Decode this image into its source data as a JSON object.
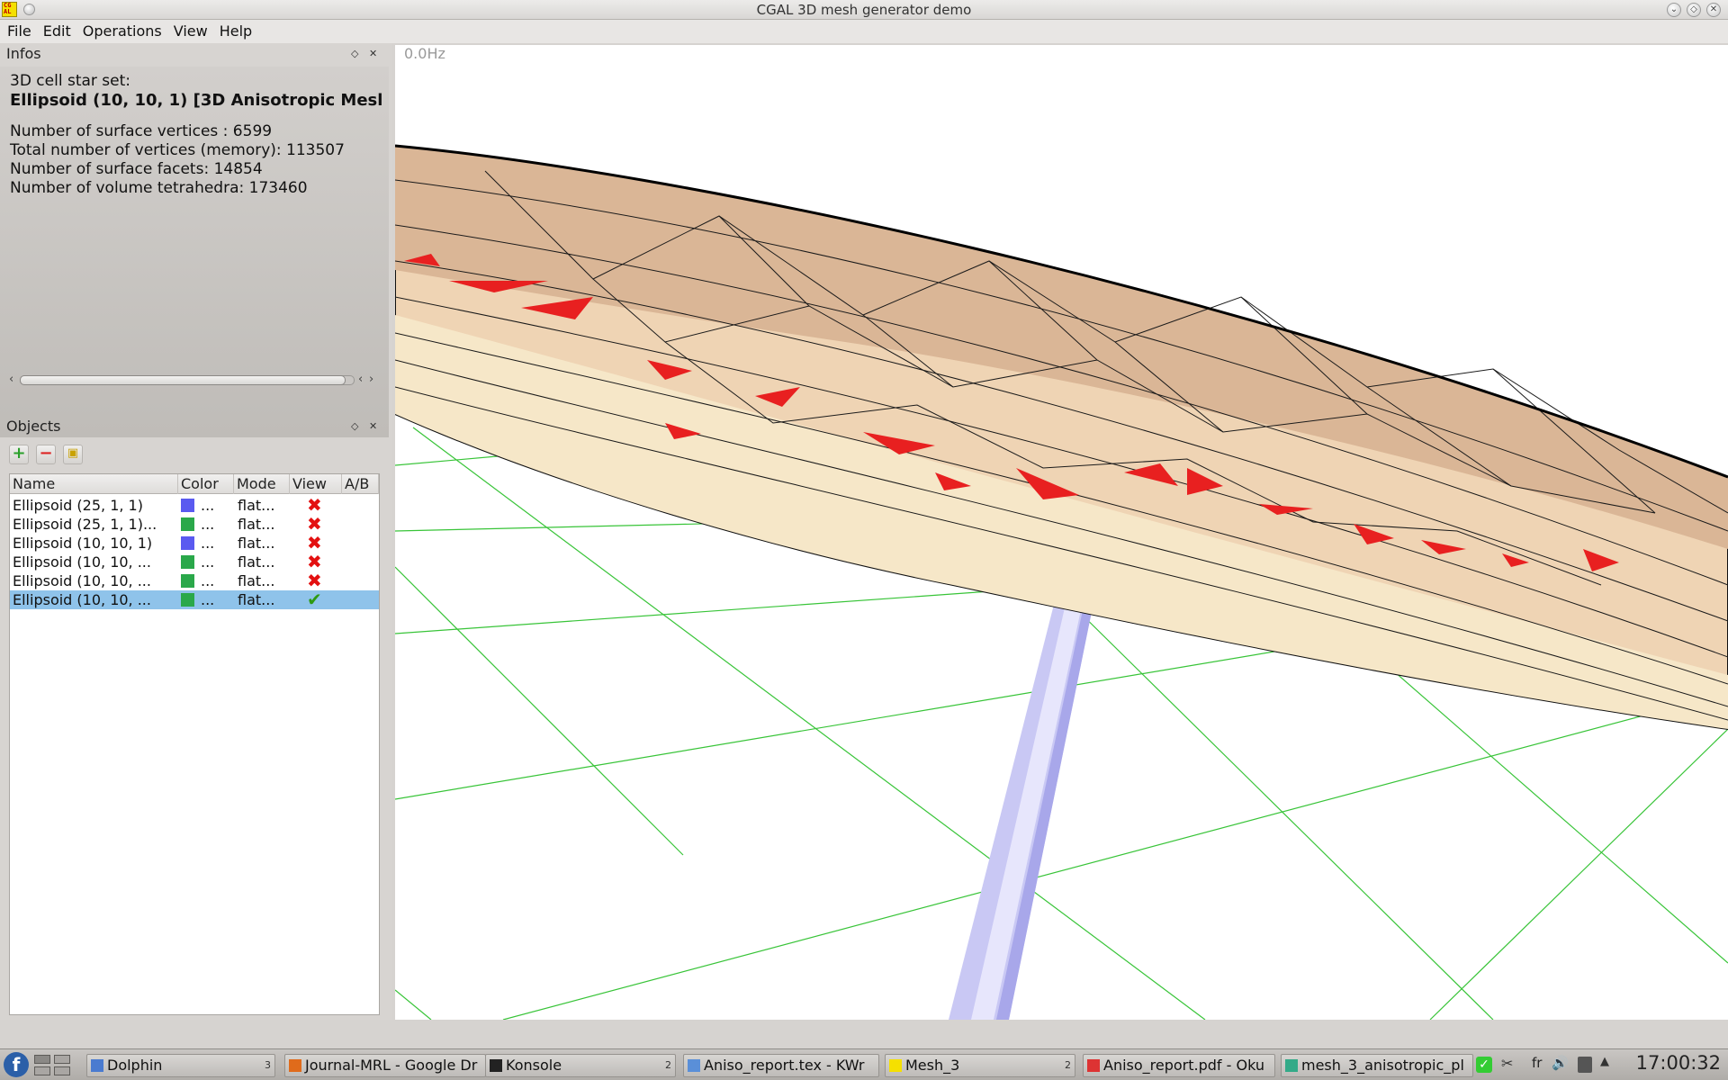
{
  "window": {
    "title": "CGAL 3D mesh generator demo",
    "app_icon_text": "CG AL"
  },
  "menu": [
    "File",
    "Edit",
    "Operations",
    "View",
    "Help"
  ],
  "infos": {
    "title": "Infos",
    "set_label": "3D cell star set:",
    "object_name": "Ellipsoid (10, 10, 1) [3D Anisotropic Mesl",
    "stats": [
      "Number of surface vertices : 6599",
      "Total number of vertices (memory): 113507",
      "Number of surface facets: 14854",
      "Number of volume tetrahedra: 173460"
    ]
  },
  "objects": {
    "title": "Objects",
    "columns": [
      "Name",
      "Color",
      "Mode",
      "View",
      "A/B"
    ],
    "rows": [
      {
        "name": "Ellipsoid (25, 1, 1)",
        "color": "#5a5af0",
        "color_label": "...",
        "mode": "flat...",
        "view": "hidden",
        "selected": false
      },
      {
        "name": "Ellipsoid (25, 1, 1)...",
        "color": "#2aa84a",
        "color_label": "...",
        "mode": "flat...",
        "view": "hidden",
        "selected": false
      },
      {
        "name": "Ellipsoid (10, 10, 1)",
        "color": "#5a5af0",
        "color_label": "...",
        "mode": "flat...",
        "view": "hidden",
        "selected": false
      },
      {
        "name": "Ellipsoid (10, 10, ...",
        "color": "#2aa84a",
        "color_label": "...",
        "mode": "flat...",
        "view": "hidden",
        "selected": false
      },
      {
        "name": "Ellipsoid (10, 10, ...",
        "color": "#2aa84a",
        "color_label": "...",
        "mode": "flat...",
        "view": "hidden",
        "selected": false
      },
      {
        "name": "Ellipsoid (10, 10, ...",
        "color": "#2aa84a",
        "color_label": "...",
        "mode": "flat...",
        "view": "visible",
        "selected": true
      }
    ]
  },
  "viewer": {
    "fps": "0.0Hz"
  },
  "taskbar": {
    "tasks": [
      {
        "label": "Dolphin",
        "num": "3",
        "icon": "dolphin-icon"
      },
      {
        "label": "Journal-MRL - Google Dr",
        "num": "",
        "icon": "firefox-icon"
      },
      {
        "label": "Konsole",
        "num": "2",
        "icon": "konsole-icon"
      },
      {
        "label": "Aniso_report.tex - KWr",
        "num": "",
        "icon": "kwrite-icon"
      },
      {
        "label": "Mesh_3",
        "num": "2",
        "icon": "cgal-icon"
      },
      {
        "label": "Aniso_report.pdf - Oku",
        "num": "",
        "icon": "okular-icon"
      },
      {
        "label": "mesh_3_anisotropic_pl",
        "num": "",
        "icon": "app-icon"
      }
    ],
    "tray_lang": "fr",
    "clock": "17:00:32"
  }
}
